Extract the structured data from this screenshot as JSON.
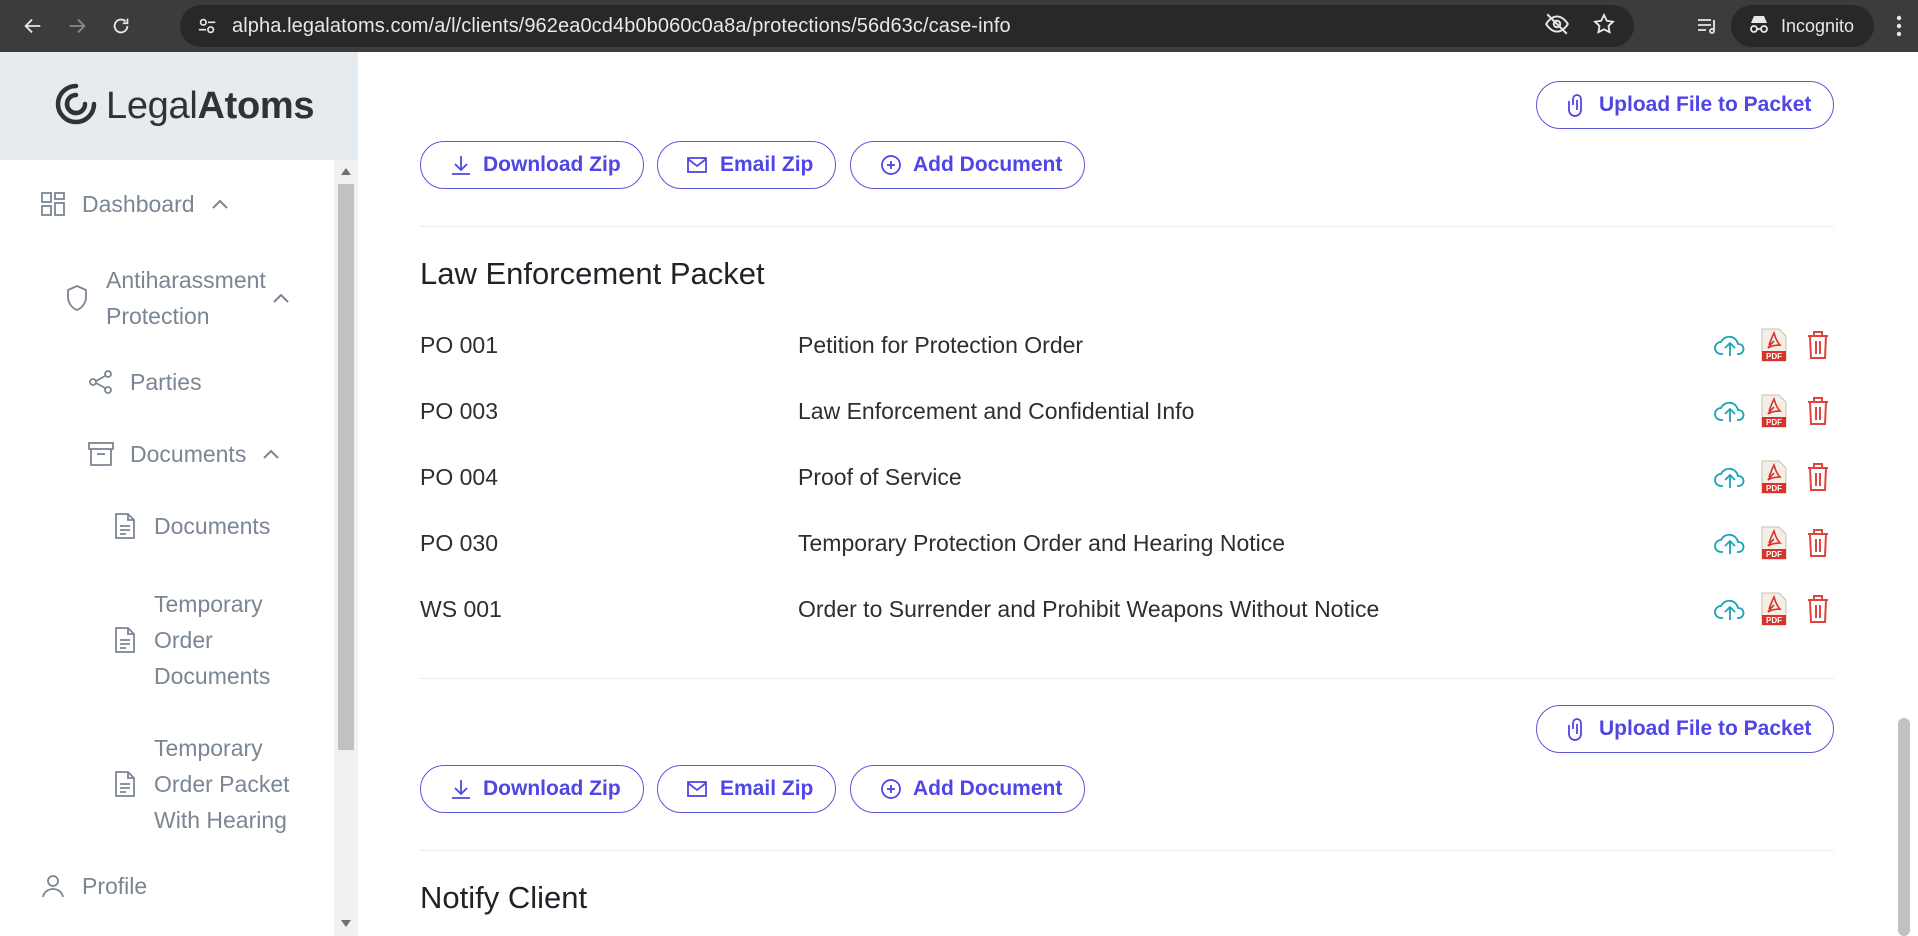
{
  "browser": {
    "url": "alpha.legalatoms.com/a/l/clients/962ea0cd4b0b060c0a8a/protections/56d63c/case-info",
    "incognito_label": "Incognito"
  },
  "sidebar": {
    "logo_light": "Legal",
    "logo_bold": "Atoms",
    "items": [
      {
        "label": "Dashboard",
        "icon": "grid-icon"
      },
      {
        "label": "Antiharassment Protection",
        "icon": "shield-icon"
      },
      {
        "label": "Parties",
        "icon": "share-icon"
      },
      {
        "label": "Documents",
        "icon": "archive-icon"
      },
      {
        "label": "Documents",
        "icon": "file-icon"
      },
      {
        "label": "Temporary Order Documents",
        "icon": "file-icon"
      },
      {
        "label": "Temporary Order Packet With Hearing",
        "icon": "file-icon"
      },
      {
        "label": "Profile",
        "icon": "user-icon"
      }
    ]
  },
  "packet_buttons": {
    "upload": "Upload File to Packet",
    "download": "Download Zip",
    "email": "Email Zip",
    "add": "Add Document"
  },
  "law_enforcement_packet": {
    "title": "Law Enforcement Packet",
    "documents": [
      {
        "code": "PO 001",
        "title": "Petition for Protection Order"
      },
      {
        "code": "PO 003",
        "title": "Law Enforcement and Confidential Info"
      },
      {
        "code": "PO 004",
        "title": "Proof of Service"
      },
      {
        "code": "PO 030",
        "title": "Temporary Protection Order and Hearing Notice"
      },
      {
        "code": "WS 001",
        "title": "Order to Surrender and Prohibit Weapons Without Notice"
      }
    ]
  },
  "notify_client": {
    "title": "Notify Client"
  },
  "colors": {
    "accent": "#4f46e5",
    "upload_icon": "#16a5b8",
    "delete_icon": "#e0443e",
    "pdf_icon": "#d9322b"
  }
}
